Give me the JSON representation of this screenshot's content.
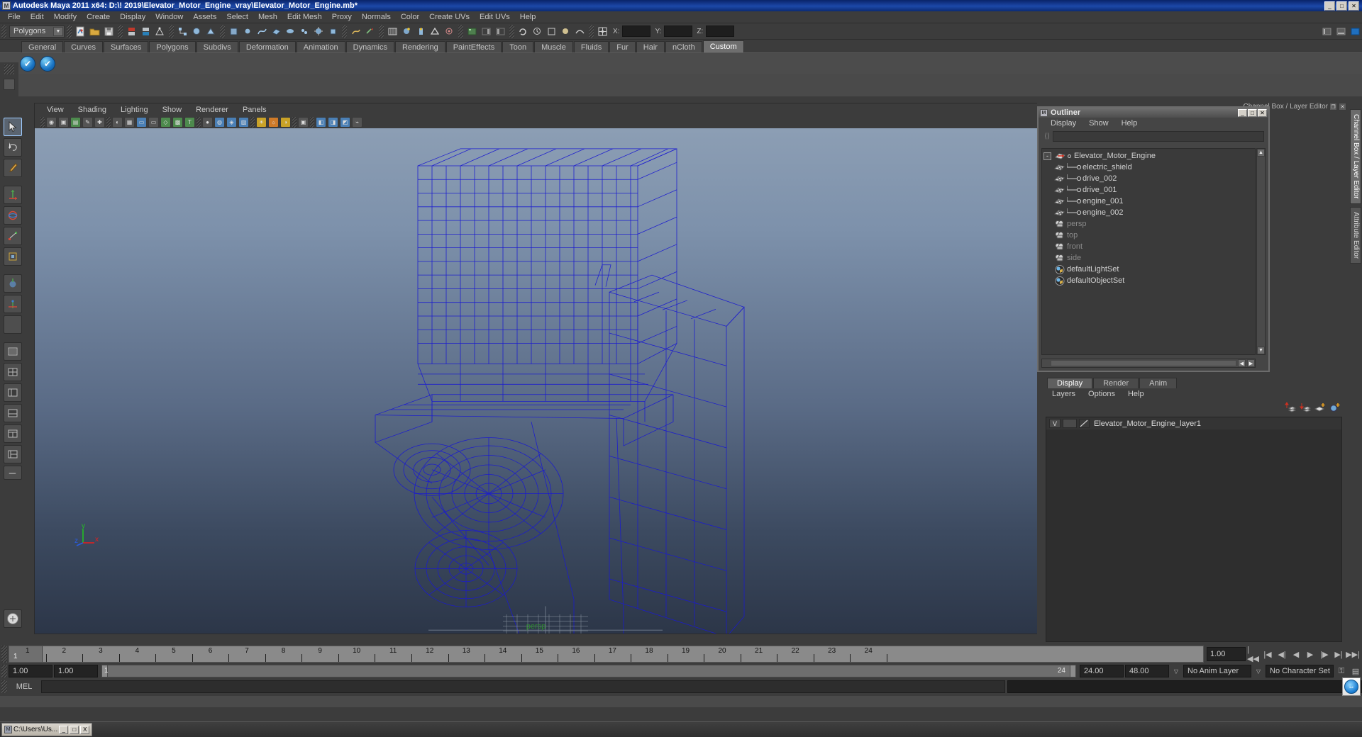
{
  "window": {
    "title": "Autodesk Maya 2011 x64: D:\\! 2019\\Elevator_Motor_Engine_vray\\Elevator_Motor_Engine.mb*",
    "icon": "maya-icon",
    "minimize": "_",
    "maximize": "□",
    "close": "✕"
  },
  "menubar": {
    "items": [
      "File",
      "Edit",
      "Modify",
      "Create",
      "Display",
      "Window",
      "Assets",
      "Select",
      "Mesh",
      "Edit Mesh",
      "Proxy",
      "Normals",
      "Color",
      "Create UVs",
      "Edit UVs",
      "Help"
    ]
  },
  "statusbar": {
    "mode_menu": "Polygons",
    "x_label": "X:",
    "y_label": "Y:",
    "z_label": "Z:",
    "x_value": "",
    "y_value": "",
    "z_value": ""
  },
  "shelf": {
    "tabs": [
      "General",
      "Curves",
      "Surfaces",
      "Polygons",
      "Subdivs",
      "Deformation",
      "Animation",
      "Dynamics",
      "Rendering",
      "PaintEffects",
      "Toon",
      "Muscle",
      "Fluids",
      "Fur",
      "Hair",
      "nCloth",
      "Custom"
    ],
    "active_tab": "Custom",
    "buttons": [
      "shelf-item-1",
      "shelf-item-2"
    ]
  },
  "viewport": {
    "menus": [
      "View",
      "Shading",
      "Lighting",
      "Show",
      "Renderer",
      "Panels"
    ],
    "camera_label": "persp",
    "axis": {
      "x": "x",
      "y": "y",
      "z": "z"
    },
    "model_color": "#1a1acd"
  },
  "rightdock": {
    "channelbox_title": "Channel Box / Layer Editor",
    "vertical_tabs": [
      "Channel Box / Layer Editor",
      "Attribute Editor"
    ],
    "active_vertical_tab": "Channel Box / Layer Editor"
  },
  "outliner": {
    "title": "Outliner",
    "menus": [
      "Display",
      "Show",
      "Help"
    ],
    "search_value": "",
    "minimize": "_",
    "maximize": "□",
    "close": "✕",
    "items": [
      {
        "label": "Elevator_Motor_Engine",
        "icon": "transform-icon",
        "level": 0,
        "expander": "-",
        "dim": false
      },
      {
        "label": "electric_shield",
        "icon": "mesh-icon",
        "level": 1,
        "expander": "",
        "dim": false
      },
      {
        "label": "drive_002",
        "icon": "mesh-icon",
        "level": 1,
        "expander": "",
        "dim": false
      },
      {
        "label": "drive_001",
        "icon": "mesh-icon",
        "level": 1,
        "expander": "",
        "dim": false
      },
      {
        "label": "engine_001",
        "icon": "mesh-icon",
        "level": 1,
        "expander": "",
        "dim": false
      },
      {
        "label": "engine_002",
        "icon": "mesh-icon",
        "level": 1,
        "expander": "",
        "dim": false
      },
      {
        "label": "persp",
        "icon": "camera-icon",
        "level": 0,
        "expander": "",
        "dim": true
      },
      {
        "label": "top",
        "icon": "camera-icon",
        "level": 0,
        "expander": "",
        "dim": true
      },
      {
        "label": "front",
        "icon": "camera-icon",
        "level": 0,
        "expander": "",
        "dim": true
      },
      {
        "label": "side",
        "icon": "camera-icon",
        "level": 0,
        "expander": "",
        "dim": true
      },
      {
        "label": "defaultLightSet",
        "icon": "set-icon",
        "level": 0,
        "expander": "",
        "dim": false
      },
      {
        "label": "defaultObjectSet",
        "icon": "set-icon",
        "level": 0,
        "expander": "",
        "dim": false
      }
    ]
  },
  "layereditor": {
    "tabs": [
      "Display",
      "Render",
      "Anim"
    ],
    "active_tab": "Display",
    "menus": [
      "Layers",
      "Options",
      "Help"
    ],
    "toolbar_icons": [
      "layer-up-icon",
      "layer-down-icon",
      "new-layer-icon",
      "new-layer-from-selected-icon"
    ],
    "layers": [
      {
        "visibility": "V",
        "type": "",
        "name": "Elevator_Motor_Engine_layer1"
      }
    ]
  },
  "timeslider": {
    "ticks": [
      "1",
      "2",
      "3",
      "4",
      "5",
      "6",
      "7",
      "8",
      "9",
      "10",
      "11",
      "12",
      "13",
      "14",
      "15",
      "16",
      "17",
      "18",
      "19",
      "20",
      "21",
      "22",
      "23",
      "24"
    ],
    "current_frame": "1",
    "current_time_field": "1.00",
    "playback_buttons": [
      "|◀◀",
      "|◀",
      "◀|",
      "◀",
      "▶",
      "|▶",
      "▶|",
      "▶▶|"
    ]
  },
  "rangeslider": {
    "start_field": "1.00",
    "end_field": "1.00",
    "range_start": "1",
    "range_end": "24",
    "anim_end": "24.00",
    "playback_end": "48.00",
    "anim_layer": "No Anim Layer",
    "character_set": "No Character Set"
  },
  "command": {
    "label": "MEL",
    "value": ""
  },
  "taskbar": {
    "items": [
      {
        "label": "C:\\Users\\Us...",
        "icon": "console-icon"
      }
    ],
    "win_buttons": [
      "_",
      "□",
      "X"
    ]
  }
}
